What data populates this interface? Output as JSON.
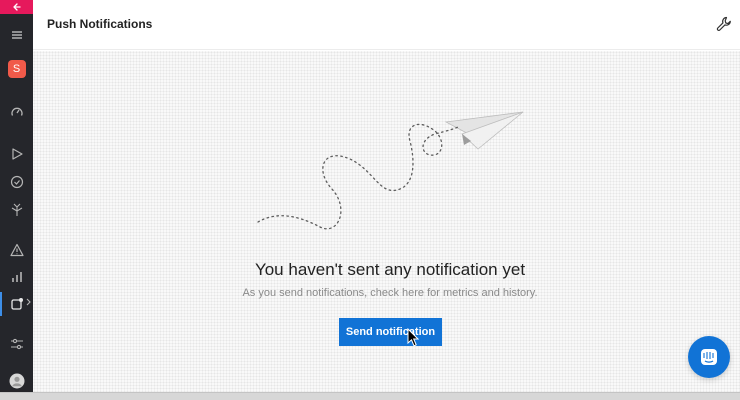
{
  "header": {
    "title": "Push Notifications"
  },
  "sidebar": {
    "avatar_letter": "S",
    "items": [
      {
        "icon": "back-arrow-icon"
      },
      {
        "icon": "menu-icon"
      },
      {
        "icon": "workspace-avatar"
      },
      {
        "icon": "dashboard-gauge-icon"
      },
      {
        "icon": "play-icon"
      },
      {
        "icon": "check-circle-icon"
      },
      {
        "icon": "branch-arrows-icon"
      },
      {
        "icon": "warning-icon"
      },
      {
        "icon": "bar-chart-icon"
      },
      {
        "icon": "notification-icon",
        "active": true
      },
      {
        "icon": "sliders-icon"
      },
      {
        "icon": "user-avatar-icon"
      }
    ]
  },
  "empty_state": {
    "title": "You haven't sent any notification yet",
    "subtitle": "As you send notifications, check here for metrics and history.",
    "button_label": "Send notification"
  },
  "colors": {
    "accent": "#1173d6",
    "sidebar_bg": "#25262b",
    "back_bar": "#e6195c",
    "avatar": "#f15a4a"
  }
}
